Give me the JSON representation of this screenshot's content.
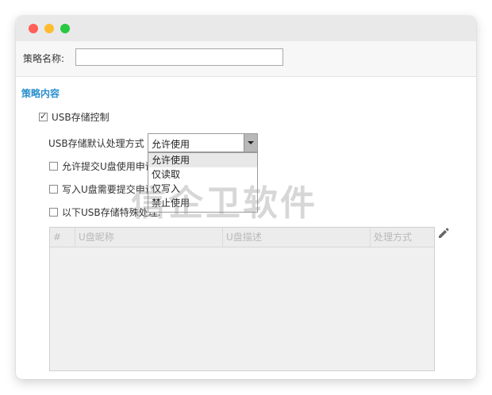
{
  "form": {
    "name_label": "策略名称:",
    "name_value": ""
  },
  "section": {
    "title": "策略内容"
  },
  "usb_control": {
    "label": "USB存储控制",
    "checked": true
  },
  "default_action": {
    "label": "USB存储默认处理方式",
    "selected": "允许使用",
    "options": [
      "允许使用",
      "仅读取",
      "仅写入",
      "禁止使用"
    ]
  },
  "options": {
    "allow_request": "允许提交U盘使用申请",
    "write_request": "写入U盘需要提交申请",
    "special": "以下USB存储特殊处理:"
  },
  "table": {
    "columns": [
      "#",
      "U盘昵称",
      "U盘描述",
      "处理方式"
    ]
  },
  "watermark": "信企卫软件",
  "icons": {
    "edit": "pencil-icon"
  }
}
